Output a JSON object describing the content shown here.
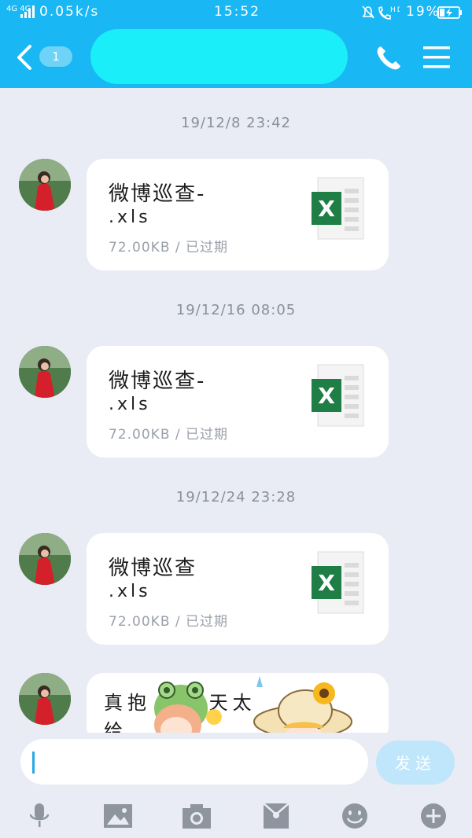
{
  "status_bar": {
    "network_type": "4G 4G",
    "speed": "0.05k/s",
    "time": "15:52",
    "hd": "HD",
    "battery_percent": "19%"
  },
  "header": {
    "unread_count": "1",
    "chat_name": ""
  },
  "messages": [
    {
      "timestamp": "19/12/8 23:42",
      "file_name_line1": "微博巡查-",
      "file_name_line2": ".xls",
      "file_meta": "72.00KB / 已过期",
      "icon": "excel-file-icon"
    },
    {
      "timestamp": "19/12/16 08:05",
      "file_name_line1": "微博巡查-",
      "file_name_line2": ".xls",
      "file_meta": "72.00KB / 已过期",
      "icon": "excel-file-icon"
    },
    {
      "timestamp": "19/12/24 23:28",
      "file_name_line1": "微博巡查",
      "file_name_line2": ".xls",
      "file_meta": "72.00KB / 已过期",
      "icon": "excel-file-icon"
    }
  ],
  "partial_message": {
    "line1": "真抱  这两天太",
    "line2": "给"
  },
  "input": {
    "value": "",
    "send_label": "发送"
  },
  "toolbar": [
    "mic-icon",
    "image-icon",
    "camera-icon",
    "red-packet-icon",
    "emoji-icon",
    "plus-icon"
  ],
  "colors": {
    "header": "#19b7f4",
    "background": "#e9ecf5",
    "excel_green": "#1f7d46",
    "send_button": "#bfe6fb"
  }
}
